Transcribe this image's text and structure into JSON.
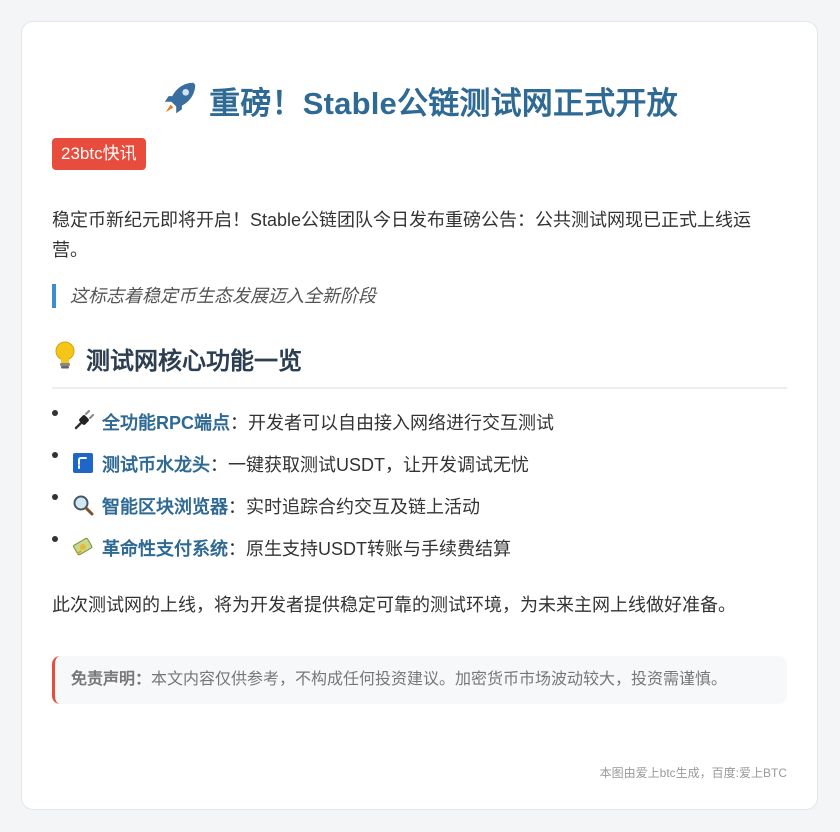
{
  "header": {
    "icon": "rocket-icon",
    "title": "重磅！Stable公链测试网正式开放"
  },
  "badge": "23btc快讯",
  "intro": "稳定币新纪元即将开启！Stable公链团队今日发布重磅公告：公共测试网现已正式上线运营。",
  "quote": "这标志着稳定币生态发展迈入全新阶段",
  "section": {
    "icon": "lightbulb-icon",
    "title": "测试网核心功能一览"
  },
  "features": [
    {
      "icon": "plug-icon",
      "name": "全功能RPC端点",
      "desc": "：开发者可以自由接入网络进行交互测试"
    },
    {
      "icon": "faucet-icon",
      "name": "测试币水龙头",
      "desc": "：一键获取测试USDT，让开发调试无忧"
    },
    {
      "icon": "magnifier-icon",
      "name": "智能区块浏览器",
      "desc": "：实时追踪合约交互及链上活动"
    },
    {
      "icon": "money-icon",
      "name": "革命性支付系统",
      "desc": "：原生支持USDT转账与手续费结算"
    }
  ],
  "closing": "此次测试网的上线，将为开发者提供稳定可靠的测试环境，为未来主网上线做好准备。",
  "disclaimer": {
    "label": "免责声明：",
    "text": "本文内容仅供参考，不构成任何投资建议。加密货币市场波动较大，投资需谨慎。"
  },
  "footer": "本图由爱上btc生成，百度:爱上BTC",
  "colors": {
    "accent": "#2f6a95",
    "badge": "#e74c3c",
    "quote_border": "#3b8ed0"
  }
}
